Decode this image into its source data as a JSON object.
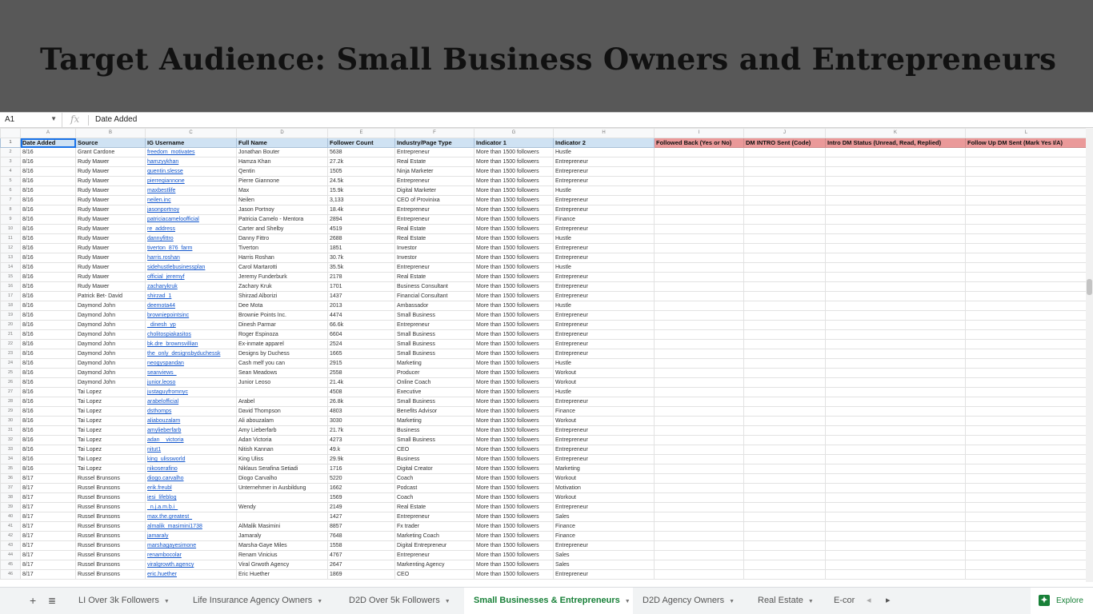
{
  "banner": {
    "title": "Target Audience: Small Business Owners and Entrepreneurs"
  },
  "formula_bar": {
    "cell": "A1",
    "fx": "fx",
    "value": "Date Added"
  },
  "column_letters": [
    "A",
    "B",
    "C",
    "D",
    "E",
    "F",
    "G",
    "H",
    "I",
    "J",
    "K",
    "L"
  ],
  "headers": [
    "Date Added",
    "Source",
    "IG Username",
    "Full Name",
    "Follower Count",
    "Industry/Page Type",
    "Indicator 1",
    "Indicator 2",
    "Followed Back (Yes or No)",
    "DM INTRO Sent (Code)",
    "Intro DM Status (Unread, Read, Replied)",
    "Follow Up DM Sent (Mark Yes I/A)"
  ],
  "rows": [
    [
      "8/16",
      "Grant Cardone",
      "freedom_motivates",
      "Jonathan Bouter",
      "5638",
      "Entrepreneur",
      "More than 1500 followers",
      "Hustle"
    ],
    [
      "8/16",
      "Rudy Mawer",
      "hamzyykhan",
      "Hamza Khan",
      "27.2k",
      "Real Estate",
      "More than 1500 followers",
      "Entrepreneur"
    ],
    [
      "8/16",
      "Rudy Mawer",
      "quentin.slesse",
      "Qentin",
      "1505",
      "Ninja Marketer",
      "More than 1500 followers",
      "Entrepreneur"
    ],
    [
      "8/16",
      "Rudy Mawer",
      "pierregiannone",
      "Pierre Giannone",
      "24.5k",
      "Entrepreneur",
      "More than 1500 followers",
      "Entrepreneur"
    ],
    [
      "8/16",
      "Rudy Mawer",
      "maxbestlife",
      "Max",
      "15.9k",
      "Digital Marketer",
      "More than 1500 followers",
      "Hustle"
    ],
    [
      "8/16",
      "Rudy Mawer",
      "neilen.inc",
      "Neilen",
      "3,133",
      "CEO of Provinixa",
      "More than 1500 followers",
      "Entrepreneur"
    ],
    [
      "8/16",
      "Rudy Mawer",
      "jasonportnoy",
      "Jason Portnoy",
      "18.4k",
      "Entrepreneur",
      "More than 1500 followers",
      "Entrepreneur"
    ],
    [
      "8/16",
      "Rudy Mawer",
      "patriciacameloofficial",
      "Patricia Camelo - Mentora",
      "2894",
      "Entrepreneur",
      "More than 1500 followers",
      "Finance"
    ],
    [
      "8/16",
      "Rudy Mawer",
      "re_address",
      "Carter and Shelby",
      "4519",
      "Real Estate",
      "More than 1500 followers",
      "Entrepreneur"
    ],
    [
      "8/16",
      "Rudy Mawer",
      "dannyfittro",
      "Danny Fittro",
      "2688",
      "Real Estate",
      "More than 1500 followers",
      "Hustle"
    ],
    [
      "8/16",
      "Rudy Mawer",
      "tiverton_876_farm",
      "Tiverton",
      "1851",
      "Investor",
      "More than 1500 followers",
      "Entrepreneur"
    ],
    [
      "8/16",
      "Rudy Mawer",
      "harris.roshan",
      "Harris Roshan",
      "30.7k",
      "Investor",
      "More than 1500 followers",
      "Entrepreneur"
    ],
    [
      "8/16",
      "Rudy Mawer",
      "sidehustlebusinessplan",
      "Carol Martarotti",
      "35.5k",
      "Entrepreneur",
      "More than 1500 followers",
      "Hustle"
    ],
    [
      "8/16",
      "Rudy Mawer",
      "official_jeremyf",
      "Jeremy Funderburk",
      "2178",
      "Real Estate",
      "More than 1500 followers",
      "Entrepreneur"
    ],
    [
      "8/16",
      "Rudy Mawer",
      "zacharykruk",
      "Zachary Kruk",
      "1701",
      "Business Consultant",
      "More than 1500 followers",
      "Entrepreneur"
    ],
    [
      "8/16",
      "Patrick Bet- David",
      "shirzad_1",
      "Shirzad Alborizi",
      "1437",
      "Financial Consultant",
      "More than 1500 followers",
      "Entrepreneur"
    ],
    [
      "8/16",
      "Daymond John",
      "deemota44",
      "Dee Mota",
      "2013",
      "Ambassador",
      "More than 1500 followers",
      "Hustle"
    ],
    [
      "8/16",
      "Daymond John",
      "browniepointsinc",
      "Brownie Points Inc.",
      "4474",
      "Small Business",
      "More than 1500 followers",
      "Entrepreneur"
    ],
    [
      "8/16",
      "Daymond John",
      "_dinesh_yp",
      "Dinesh Parmar",
      "66.6k",
      "Entrepreneur",
      "More than 1500 followers",
      "Entrepreneur"
    ],
    [
      "8/16",
      "Daymond John",
      "cholitospiakasitos",
      "Roger Espinoza",
      "6604",
      "Small Business",
      "More than 1500 followers",
      "Entrepreneur"
    ],
    [
      "8/16",
      "Daymond John",
      "bk.dre_brownsvillian",
      "Ex-inmate apparel",
      "2524",
      "Small Business",
      "More than 1500 followers",
      "Entrepreneur"
    ],
    [
      "8/16",
      "Daymond John",
      "the_only_designsbyduchessk",
      "Designs by Duchess",
      "1665",
      "Small Business",
      "More than 1500 followers",
      "Entrepreneur"
    ],
    [
      "8/16",
      "Daymond John",
      "neogyspandan",
      "Cash melf you can",
      "2915",
      "Marketing",
      "More than 1500 followers",
      "Hustle"
    ],
    [
      "8/16",
      "Daymond John",
      "seanviews_",
      "Sean Meadows",
      "2558",
      "Producer",
      "More than 1500 followers",
      "Workout"
    ],
    [
      "8/16",
      "Daymond John",
      "junior.leoso",
      "Junior Leoso",
      "21.4k",
      "Online Coach",
      "More than 1500 followers",
      "Workout"
    ],
    [
      "8/16",
      "Tai Lopez",
      "justaguyfromnyc",
      "",
      "4508",
      "Executive",
      "More than 1500 followers",
      "Hustle"
    ],
    [
      "8/16",
      "Tai Lopez",
      "arabelofficial",
      "Arabel",
      "26.8k",
      "Small Business",
      "More than 1500 followers",
      "Entrepreneur"
    ],
    [
      "8/16",
      "Tai Lopez",
      "dsthomps",
      "David Thompson",
      "4803",
      "Benefits Advisor",
      "More than 1500 followers",
      "Finance"
    ],
    [
      "8/16",
      "Tai Lopez",
      "aliabouzalam",
      "Ali abouzalam",
      "3030",
      "Marketing",
      "More than 1500 followers",
      "Workout"
    ],
    [
      "8/16",
      "Tai Lopez",
      "amylieberfarb",
      "Amy Lieberfarb",
      "21.7k",
      "Business",
      "More than 1500 followers",
      "Entrepreneur"
    ],
    [
      "8/16",
      "Tai Lopez",
      "adan__victoria",
      "Adan Victoria",
      "4273",
      "Small Business",
      "More than 1500 followers",
      "Entrepreneur"
    ],
    [
      "8/16",
      "Tai Lopez",
      "nitut1",
      "Nitish Kannan",
      "49.k",
      "CEO",
      "More than 1500 followers",
      "Entrepreneur"
    ],
    [
      "8/16",
      "Tai Lopez",
      "king_ulissworld",
      "King Uliss",
      "29.9k",
      "Business",
      "More than 1500 followers",
      "Entrepreneur"
    ],
    [
      "8/16",
      "Tai Lopez",
      "nikoserafino",
      "Niklaus Serafina Setiadi",
      "1716",
      "Digital Creator",
      "More than 1500 followers",
      "Marketing"
    ],
    [
      "8/17",
      "Russel Brunsons",
      "diogo.carvalho",
      "Diogo Carvalho",
      "5220",
      "Coach",
      "More than 1500 followers",
      "Workout"
    ],
    [
      "8/17",
      "Russel Brunsons",
      "erik.freubl",
      "Unternehmer in Ausbildung",
      "1662",
      "Podcast",
      "More than 1500 followers",
      "Motivation"
    ],
    [
      "8/17",
      "Russel Brunsons",
      "iesi_lifeblog",
      "",
      "1569",
      "Coach",
      "More than 1500 followers",
      "Workout"
    ],
    [
      "8/17",
      "Russel Brunsons",
      "_n.j.a.m.b.i_",
      "Wendy",
      "2149",
      "Real Estate",
      "More than 1500 followers",
      "Entrepreneur"
    ],
    [
      "8/17",
      "Russel Brunsons",
      "max.the.greatest_",
      "",
      "1427",
      "Entrepreneur",
      "More than 1500 followers",
      "Sales"
    ],
    [
      "8/17",
      "Russel Brunsons",
      "almalik_masimini1738",
      "AlMalik Masimini",
      "8857",
      "Fx trader",
      "More than 1500 followers",
      "Finance"
    ],
    [
      "8/17",
      "Russel Brunsons",
      "jamaraly",
      "Jamaraly",
      "7648",
      "Marketing Coach",
      "More than 1500 followers",
      "Finance"
    ],
    [
      "8/17",
      "Russel Brunsons",
      "marshagayesimone",
      "Marsha-Gaye Miles",
      "1558",
      "Digital Entrepreneur",
      "More than 1500 followers",
      "Entrepreneur"
    ],
    [
      "8/17",
      "Russel Brunsons",
      "renambocolar",
      "Renam Vinicius",
      "4767",
      "Entrepreneur",
      "More than 1500 followers",
      "Sales"
    ],
    [
      "8/17",
      "Russel Brunsons",
      "viralgrowth.agency",
      "Viral Grwoth Agency",
      "2647",
      "Markenting Agency",
      "More than 1500 followers",
      "Sales"
    ],
    [
      "8/17",
      "Russel Brunsons",
      "eric.huether",
      "Eric Huether",
      "1869",
      "CEO",
      "More than 1500 followers",
      "Entrepreneur"
    ]
  ],
  "tabs": [
    {
      "label": "LI Over 3k Followers"
    },
    {
      "label": "Life Insurance Agency Owners"
    },
    {
      "label": "D2D Over 5k Followers"
    },
    {
      "label": "Small Businesses & Entrepreneurs"
    },
    {
      "label": "D2D Agency Owners"
    },
    {
      "label": "Real Estate"
    },
    {
      "label": "E-cor"
    }
  ],
  "explore": {
    "label": "Explore"
  },
  "colors": {
    "header_blue": "#cfe2f3",
    "header_pink": "#ea9999",
    "active_tab": "#188038",
    "link": "#1155cc"
  },
  "icons": {
    "add_sheet": "plus-icon",
    "all_sheets": "menu-icon",
    "scroll_left": "chevron-left-icon",
    "scroll_right": "chevron-right-icon",
    "explore": "explore-icon"
  }
}
